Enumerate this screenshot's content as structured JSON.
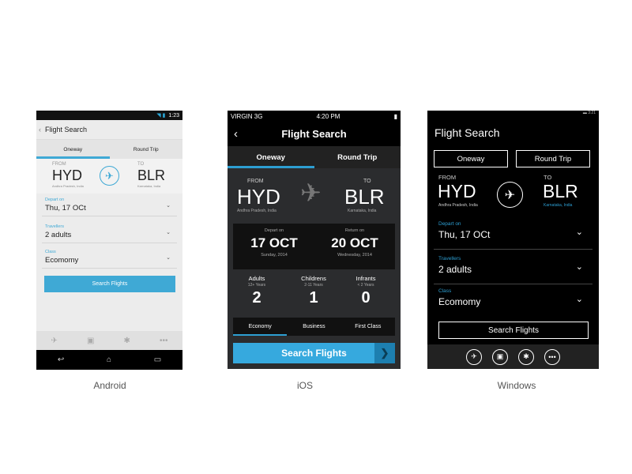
{
  "captions": {
    "android": "Android",
    "ios": "iOS",
    "windows": "Windows"
  },
  "android": {
    "status_time": "1:23",
    "title": "Flight Search",
    "tabs": [
      "Oneway",
      "Round Trip"
    ],
    "from": {
      "label": "FROM",
      "code": "HYD",
      "place": "Andhra Pradesh, India"
    },
    "to": {
      "label": "TO",
      "code": "BLR",
      "place": "Karnataka, India"
    },
    "depart": {
      "label": "Depart on",
      "value": "Thu, 17 OCt"
    },
    "travellers": {
      "label": "Travellers",
      "value": "2 adults"
    },
    "class": {
      "label": "Class",
      "value": "Ecomomy"
    },
    "search_label": "Search Flights"
  },
  "ios": {
    "carrier": "VIRGIN  3G",
    "time": "4:20 PM",
    "title": "Flight Search",
    "tabs": [
      "Oneway",
      "Round Trip"
    ],
    "from": {
      "label": "FROM",
      "code": "HYD",
      "place": "Andhra Pradesh, India"
    },
    "to": {
      "label": "TO",
      "code": "BLR",
      "place": "Karnataka, India"
    },
    "depart": {
      "label": "Depart on",
      "date": "17 OCT",
      "day": "Sunday, 2014"
    },
    "return": {
      "label": "Return on",
      "date": "20 OCT",
      "day": "Wednesday, 2014"
    },
    "passengers": [
      {
        "label": "Adults",
        "sub": "12+ Years",
        "count": "2"
      },
      {
        "label": "Childrens",
        "sub": "2-11 Years",
        "count": "1"
      },
      {
        "label": "Infrants",
        "sub": "< 2 Years",
        "count": "0"
      }
    ],
    "classes": [
      "Economy",
      "Business",
      "First Class"
    ],
    "search_label": "Search Flights"
  },
  "windows": {
    "status_time": "3:21",
    "title": "Flight Search",
    "tabs": [
      "Oneway",
      "Round Trip"
    ],
    "from": {
      "label": "FROM",
      "code": "HYD",
      "place": "Andhra Pradesh, India"
    },
    "to": {
      "label": "TO",
      "code": "BLR",
      "place": "Karnataka, India"
    },
    "depart": {
      "label": "Depart on",
      "value": "Thu, 17 OCt"
    },
    "travellers": {
      "label": "Travellers",
      "value": "2 adults"
    },
    "class": {
      "label": "Class",
      "value": "Ecomomy"
    },
    "search_label": "Search Flights"
  },
  "colors": {
    "accent": "#3fa9d5",
    "ios_accent": "#2d9ed2"
  },
  "icons": [
    "plane-icon",
    "briefcase-icon",
    "gear-icon",
    "more-icon",
    "back-icon",
    "home-icon",
    "recents-icon",
    "chevron-down-icon"
  ]
}
